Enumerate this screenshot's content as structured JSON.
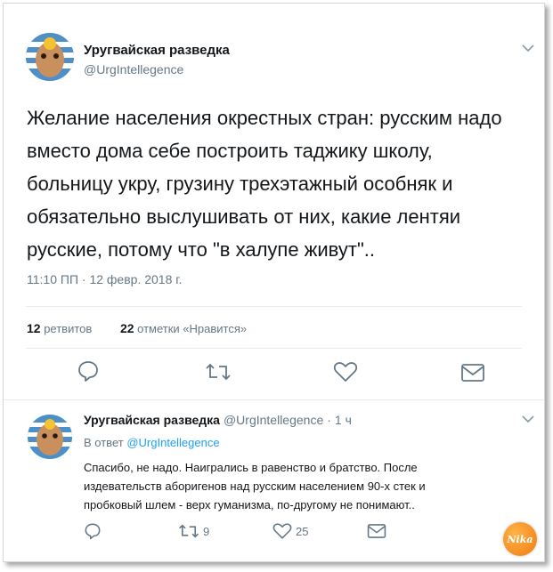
{
  "tweet": {
    "display_name": "Уругвайская разведка",
    "handle": "@UrgIntellegence",
    "text_lines": [
      "Желание населения окрестных стран: русским надо",
      "вместо дома себе построить таджику школу,",
      "больницу укру, грузину трехэтажный особняк и",
      "обязательно выслушивать от них, какие лентяи",
      "русские, потому что \"в халупе живут\".."
    ],
    "timestamp": "11:10 ПП · 12 февр. 2018 г.",
    "stats": {
      "retweets_count": "12",
      "retweets_label": "ретвитов",
      "likes_count": "22",
      "likes_label": "отметки «Нравится»"
    },
    "actions": [
      "reply-icon",
      "retweet-icon",
      "like-icon",
      "message-icon"
    ]
  },
  "reply": {
    "display_name": "Уругвайская разведка",
    "handle": "@UrgIntellegence",
    "separator": "·",
    "time": "1 ч",
    "reply_to_prefix": "В ответ",
    "reply_to_handle": "@UrgIntellegence",
    "text_lines": [
      "Спасибо, не надо. Наигрались в равенство и братство. После",
      "издевательств аборигенов над русским населением 90-х стек и",
      "пробковый шлем - верх гуманизма, по-другому не понимают.."
    ],
    "retweets": "9",
    "likes": "25"
  },
  "watermark": {
    "text": "Nika"
  },
  "colors": {
    "text": "#14171a",
    "secondary": "#657786",
    "link": "#1da1f2",
    "divider": "#e6ecf0"
  }
}
